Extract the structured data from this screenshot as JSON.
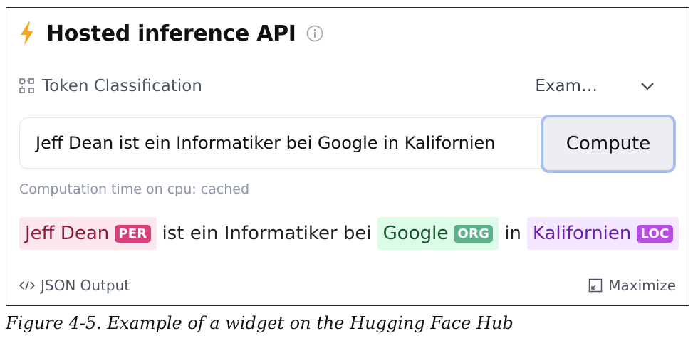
{
  "widget": {
    "title": "Hosted inference API",
    "task": "Token Classification",
    "examples_label": "Exam…",
    "input_value": "Jeff Dean ist ein Informatiker bei Google in Kalifornien",
    "compute_label": "Compute",
    "computation_time": "Computation time on cpu: cached",
    "output": {
      "ent1_text": "Jeff Dean",
      "ent1_tag": "PER",
      "text1": "ist ein Informatiker bei",
      "ent2_text": "Google",
      "ent2_tag": "ORG",
      "text2": "in",
      "ent3_text": "Kalifornien",
      "ent3_tag": "LOC"
    },
    "json_output_label": "JSON Output",
    "maximize_label": "Maximize"
  },
  "caption": "Figure 4-5. Example of a widget on the Hugging Face Hub",
  "colors": {
    "bolt": "#f5a623",
    "per_bg": "#fce7ef",
    "per_tag": "#d63f7a",
    "org_bg": "#dcfce7",
    "org_tag": "#5fae8d",
    "loc_bg": "#f3e8ff",
    "loc_tag": "#b64fe0",
    "compute_border": "#a8bff0"
  },
  "icons": {
    "header": "lightning-icon",
    "info": "info-icon",
    "task": "token-classification-icon",
    "dropdown": "chevron-down-icon",
    "json": "code-icon",
    "maximize": "maximize-icon"
  }
}
